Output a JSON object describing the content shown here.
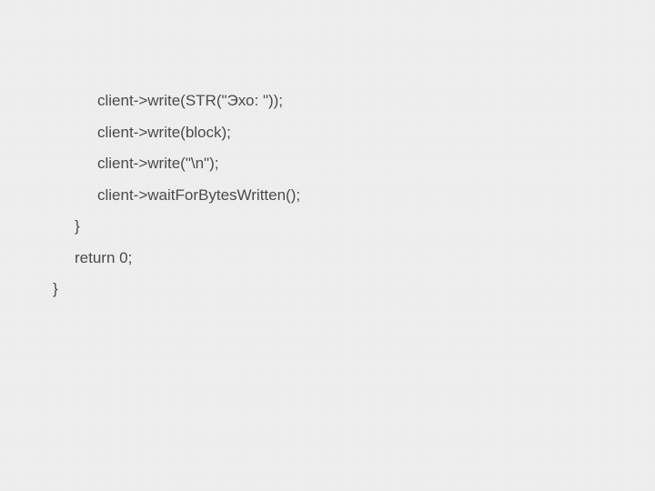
{
  "code": {
    "lines": [
      {
        "indent": "indent-3",
        "text": "client->write(STR(\"Эхо: \"));"
      },
      {
        "indent": "indent-3",
        "text": "client->write(block);"
      },
      {
        "indent": "indent-3",
        "text": "client->write(\"\\n\");"
      },
      {
        "indent": "indent-3",
        "text": "client->waitForBytesWritten();"
      },
      {
        "indent": "indent-2",
        "text": "}"
      },
      {
        "indent": "indent-2",
        "text": "return 0;"
      },
      {
        "indent": "indent-1",
        "text": "}"
      }
    ]
  }
}
